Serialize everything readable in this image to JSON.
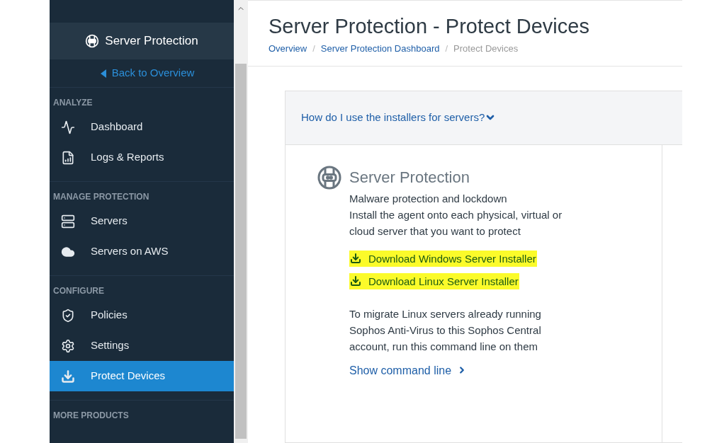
{
  "sidebar": {
    "product": "Server Protection",
    "back_link": "Back to Overview",
    "sections": [
      {
        "heading": "ANALYZE",
        "items": [
          {
            "label": "Dashboard",
            "selected": false
          },
          {
            "label": "Logs & Reports",
            "selected": false
          }
        ]
      },
      {
        "heading": "MANAGE PROTECTION",
        "items": [
          {
            "label": "Servers",
            "selected": false
          },
          {
            "label": "Servers on AWS",
            "selected": false
          }
        ]
      },
      {
        "heading": "CONFIGURE",
        "items": [
          {
            "label": "Policies",
            "selected": false
          },
          {
            "label": "Settings",
            "selected": false
          },
          {
            "label": "Protect Devices",
            "selected": true
          }
        ]
      },
      {
        "heading": "MORE PRODUCTS"
      }
    ]
  },
  "page": {
    "title": "Server Protection - Protect Devices",
    "breadcrumbs": [
      {
        "label": "Overview",
        "current": false
      },
      {
        "separator": "/",
        "label": "Server Protection Dashboard",
        "current": false
      },
      {
        "separator": "/",
        "label": "Protect Devices",
        "current": true
      }
    ],
    "faq": {
      "label": "How do I use the installers for servers?",
      "expanded": false
    },
    "card": {
      "title": "Server Protection",
      "lines": [
        "Malware protection and lockdown",
        "Install the agent onto each physical, virtual or cloud server that you want to protect"
      ],
      "downloads": [
        {
          "label": "Download Windows Server Installer",
          "highlighted": true
        },
        {
          "label": "Download Linux Server Installer",
          "highlighted": true
        }
      ],
      "migrate_text": "To migrate Linux servers already running Sophos Anti-Virus to this Sophos Central account, run this command line on them",
      "command_link": "Show command line"
    }
  }
}
